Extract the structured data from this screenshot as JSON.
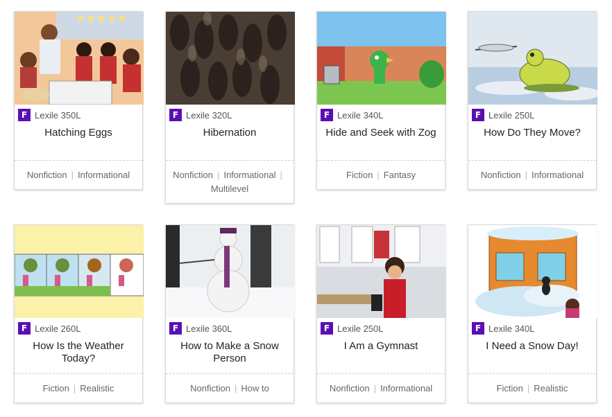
{
  "books": [
    {
      "level": "F",
      "lexile": "Lexile 350L",
      "title": "Hatching Eggs",
      "genres": [
        "Nonfiction",
        "Informational"
      ]
    },
    {
      "level": "F",
      "lexile": "Lexile 320L",
      "title": "Hibernation",
      "genres": [
        "Nonfiction",
        "Informational",
        "Multilevel"
      ]
    },
    {
      "level": "F",
      "lexile": "Lexile 340L",
      "title": "Hide and Seek with Zog",
      "genres": [
        "Fiction",
        "Fantasy"
      ]
    },
    {
      "level": "F",
      "lexile": "Lexile 250L",
      "title": "How Do They Move?",
      "genres": [
        "Nonfiction",
        "Informational"
      ]
    },
    {
      "level": "F",
      "lexile": "Lexile 260L",
      "title": "How Is the Weather Today?",
      "genres": [
        "Fiction",
        "Realistic"
      ]
    },
    {
      "level": "F",
      "lexile": "Lexile 360L",
      "title": "How to Make a Snow Person",
      "genres": [
        "Nonfiction",
        "How to"
      ]
    },
    {
      "level": "F",
      "lexile": "Lexile 250L",
      "title": "I Am a Gymnast",
      "genres": [
        "Nonfiction",
        "Informational"
      ]
    },
    {
      "level": "F",
      "lexile": "Lexile 340L",
      "title": "I Need a Snow Day!",
      "genres": [
        "Fiction",
        "Realistic"
      ]
    }
  ],
  "colors": {
    "level_badge": "#5b0fb3"
  }
}
